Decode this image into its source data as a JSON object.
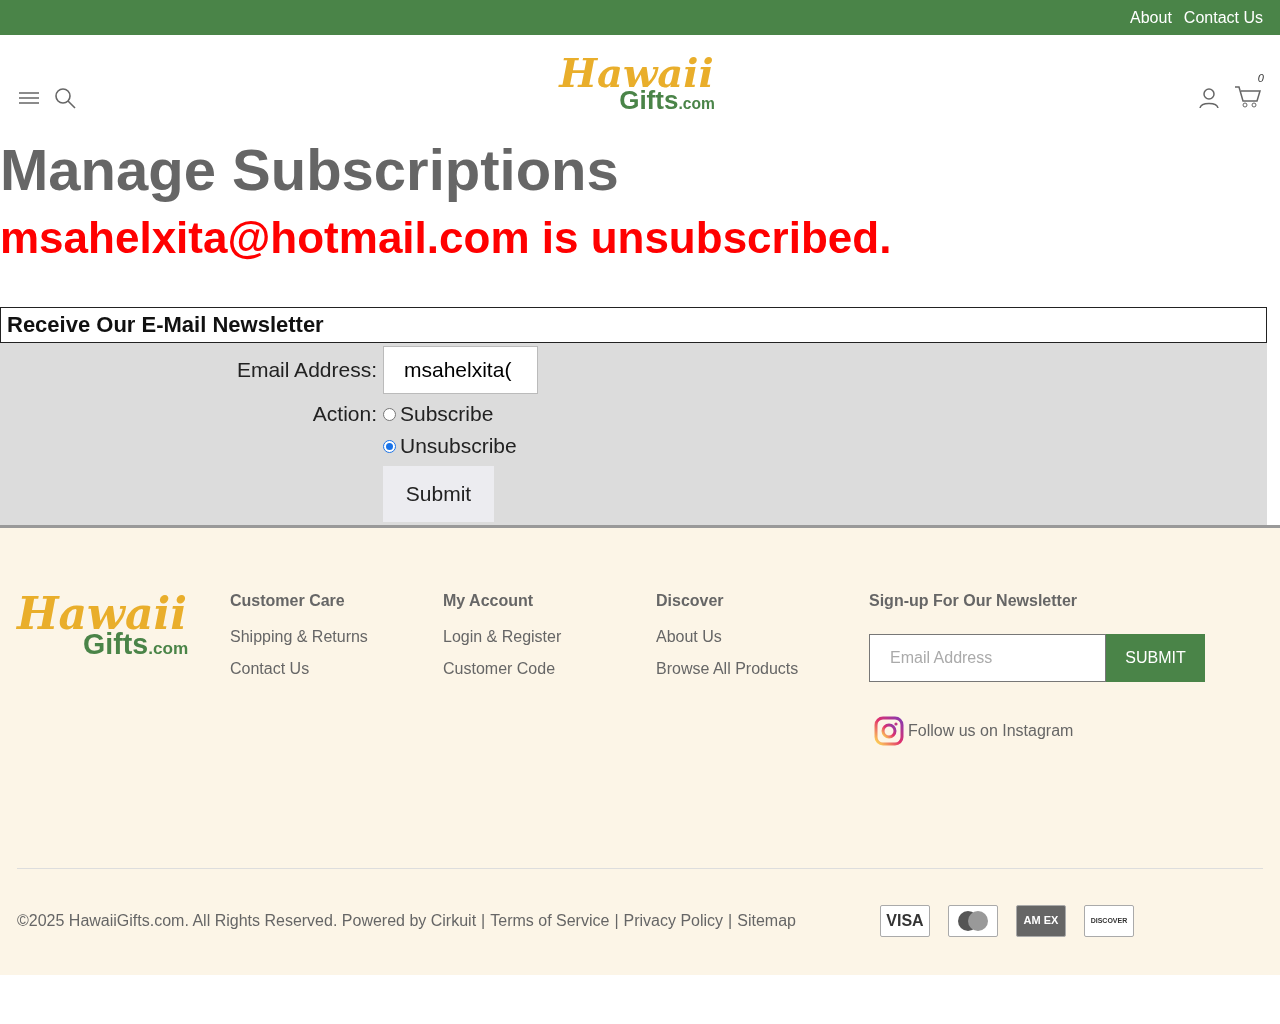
{
  "top_links": [
    "About",
    "Contact Us"
  ],
  "header": {
    "logo": {
      "line1": "Hawaii",
      "line2": "Gifts",
      ".com": ".com"
    },
    "cart_count": "0"
  },
  "title": "Manage Subscriptions",
  "message": "msahelxita@hotmail.com is unsubscribed.",
  "newsletter_form": {
    "heading": "Receive Our E-Mail Newsletter",
    "email_label": "Email Address:",
    "email_value": "msahelxita(",
    "action_label": "Action:",
    "options": [
      {
        "label": "Subscribe",
        "selected": false
      },
      {
        "label": "Unsubscribe",
        "selected": true
      }
    ],
    "submit": "Submit"
  },
  "footer": {
    "logo": {
      "line1": "Hawaii",
      "line2": "Gifts",
      ".com": ".com"
    },
    "columns": [
      {
        "heading": "Customer Care",
        "links": [
          "Shipping & Returns",
          "Contact Us"
        ]
      },
      {
        "heading": "My Account",
        "links": [
          "Login & Register",
          "Customer Code"
        ]
      },
      {
        "heading": "Discover",
        "links": [
          "About Us",
          "Browse All Products"
        ]
      }
    ],
    "newsletter": {
      "heading": "Sign-up For Our Newsletter",
      "placeholder": "Email Address",
      "button": "SUBMIT",
      "instagram": "Follow us on Instagram"
    },
    "copyright": "©2025 HawaiiGifts.com. All Rights Reserved. Powered by Cirkuit",
    "legal_links": [
      {
        "separator": "|",
        "label": "Terms of Service"
      },
      {
        "separator": "|",
        "label": "Privacy Policy"
      },
      {
        "separator": "|",
        "label": "Sitemap"
      }
    ],
    "cards": [
      {
        "kind": "visa",
        "label": "VISA"
      },
      {
        "kind": "mastercard"
      },
      {
        "kind": "amex",
        "label": "AM EX"
      },
      {
        "kind": "discover",
        "label": "DISCOVER"
      }
    ]
  }
}
